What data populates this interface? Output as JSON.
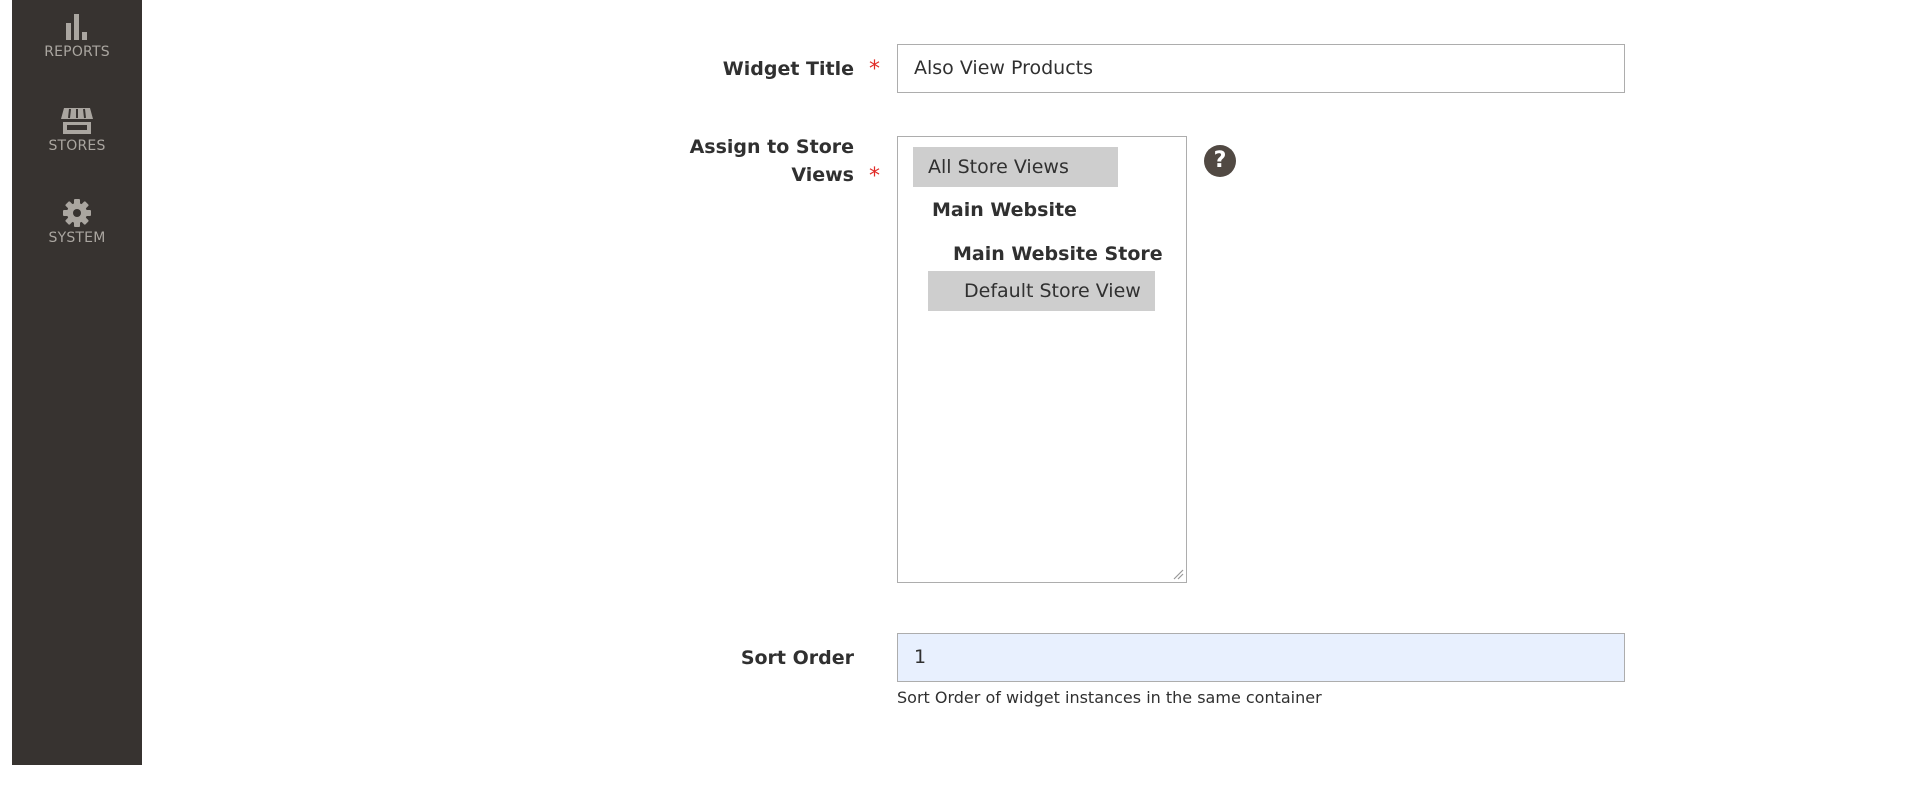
{
  "sidebar": {
    "items": [
      {
        "label": "REPORTS",
        "icon": "bar-chart-icon"
      },
      {
        "label": "STORES",
        "icon": "storefront-icon"
      },
      {
        "label": "SYSTEM",
        "icon": "gear-icon"
      }
    ]
  },
  "form": {
    "widget_title": {
      "label": "Widget Title",
      "value": "Also View Products",
      "required_mark": "*"
    },
    "store_views": {
      "label_line1": "Assign to Store",
      "label_line2": "Views",
      "required_mark": "*",
      "options": [
        {
          "text": "All Store Views",
          "selected": true
        },
        {
          "text": "Main Website",
          "group": true
        },
        {
          "text": "Main Website Store",
          "group": true
        },
        {
          "text": "Default Store View",
          "selected": true
        }
      ],
      "help_glyph": "?"
    },
    "sort_order": {
      "label": "Sort Order",
      "value": "1",
      "note": "Sort Order of widget instances in the same container"
    }
  },
  "colors": {
    "sidebar_bg": "#373330",
    "sidebar_text": "#aaa6a0",
    "required": "#e02b27",
    "selected_option": "#cecece",
    "autofill_bg": "#e8f0fe"
  }
}
